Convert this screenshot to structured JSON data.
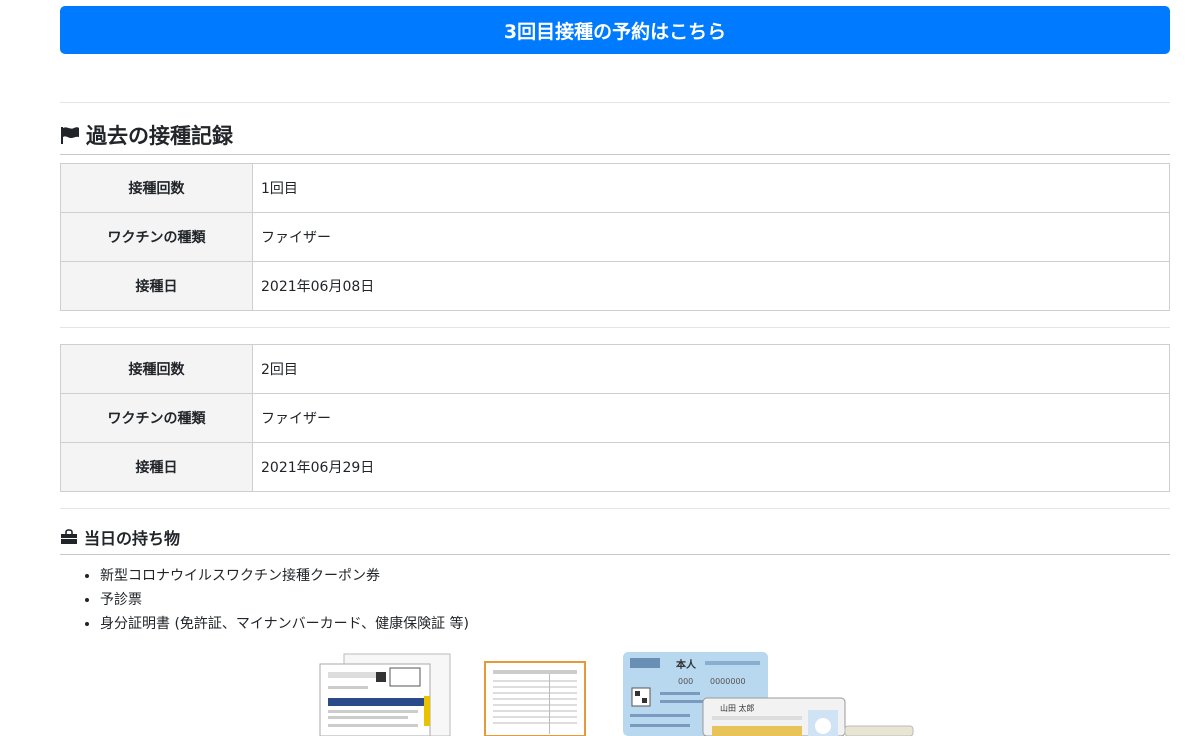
{
  "reserve_button": {
    "label": "3回目接種の予約はこちら"
  },
  "past_records": {
    "title": "過去の接種記録",
    "records": [
      {
        "rows": [
          {
            "label": "接種回数",
            "value": "1回目"
          },
          {
            "label": "ワクチンの種類",
            "value": "ファイザー"
          },
          {
            "label": "接種日",
            "value": "2021年06月08日"
          }
        ]
      },
      {
        "rows": [
          {
            "label": "接種回数",
            "value": "2回目"
          },
          {
            "label": "ワクチンの種類",
            "value": "ファイザー"
          },
          {
            "label": "接種日",
            "value": "2021年06月29日"
          }
        ]
      }
    ]
  },
  "items_section": {
    "title": "当日の持ち物",
    "items": [
      "新型コロナウイルスワクチン接種クーポン券",
      "予診票",
      "身分証明書 (免許証、マイナンバーカード、健康保険証 等)"
    ]
  },
  "card_image": {
    "label_ja": "本人",
    "digits": "000",
    "number": "0000000",
    "name": "山田 太郎"
  },
  "icons": {
    "past": "flag-icon",
    "items": "bag-icon"
  },
  "colors": {
    "primary": "#007bff",
    "header_cell": "#f4f4f4"
  }
}
